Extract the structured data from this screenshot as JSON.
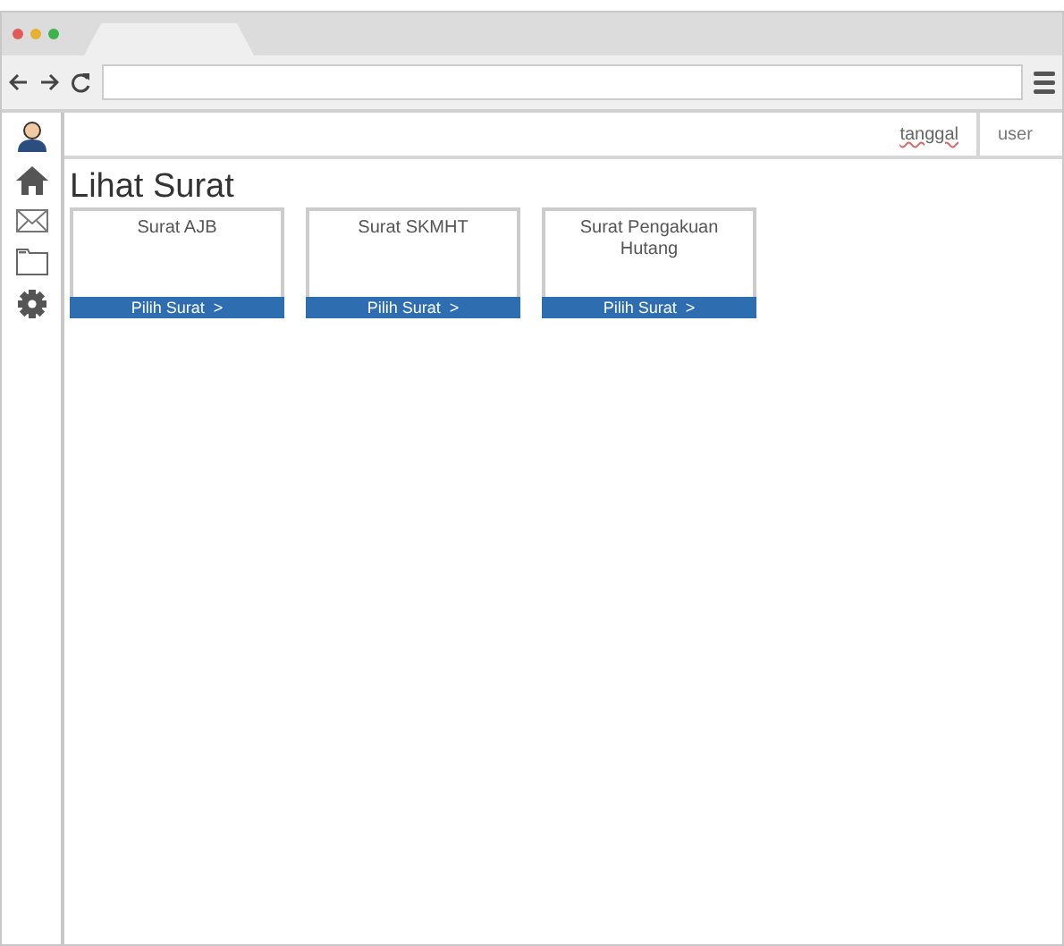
{
  "header": {
    "date_label": "tanggal",
    "user_label": "user"
  },
  "page": {
    "title": "Lihat Surat"
  },
  "cards": [
    {
      "title": "Surat AJB",
      "action": "Pilih Surat  >"
    },
    {
      "title": "Surat SKMHT",
      "action": "Pilih Surat  >"
    },
    {
      "title": "Surat Pengakuan Hutang",
      "action": "Pilih Surat  >"
    }
  ]
}
